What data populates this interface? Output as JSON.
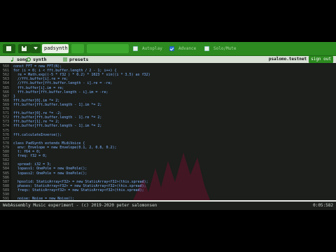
{
  "toolbar": {
    "project": "padsynth",
    "checkboxes": [
      {
        "label": "Autoplay",
        "checked": false
      },
      {
        "label": "Advance",
        "checked": true
      },
      {
        "label": "Solo/Mute",
        "checked": false
      }
    ]
  },
  "tabs": [
    {
      "label": "song",
      "icon": "music-icon"
    },
    {
      "label": "synth",
      "icon": "gear-icon"
    },
    {
      "label": "presets",
      "icon": "list-icon"
    }
  ],
  "account": {
    "user": "psalomo.testnet",
    "action": "sign out"
  },
  "editor": {
    "lines": [
      {
        "n": "560",
        "t": "const FFT = new FFT(N);"
      },
      {
        "n": "561",
        "t": "for (i = 0; i < fft.buffer.length / 2 - 1; i++) {"
      },
      {
        "n": "562",
        "t": "  re = Math.exp((-5 * f32 ) * 0.2) * 1023 * sin((i * 3.5) as f32)"
      },
      {
        "n": "563",
        "t": "  //fft.buffer[i].re = re;"
      },
      {
        "n": "564",
        "t": "  //fft.buffer[fft.buffer.length - i].re = -re;"
      },
      {
        "n": "565",
        "t": "  fft.buffer[i].im = re;"
      },
      {
        "n": "566",
        "t": "  fft.buffer[fft.buffer.length - i].im = -re;"
      },
      {
        "n": "567",
        "t": "}"
      },
      {
        "n": "568",
        "t": "fft.buffer[0].im *= 2;"
      },
      {
        "n": "569",
        "t": "fft.buffer[fft.buffer.length - 1].im *= 2;"
      },
      {
        "n": "570",
        "t": ""
      },
      {
        "n": "571",
        "t": "fft.buffer[0].re *= -2;"
      },
      {
        "n": "572",
        "t": "fft.buffer[fft.buffer.length - 1].re *= 2;"
      },
      {
        "n": "573",
        "t": "fft.buffer[1].re *= 2;"
      },
      {
        "n": "574",
        "t": "fft.buffer[fft.buffer.length - 1].im *= 2;"
      },
      {
        "n": "575",
        "t": ""
      },
      {
        "n": "576",
        "t": "fft.calculateInverse();"
      },
      {
        "n": "577",
        "t": ""
      },
      {
        "n": "578",
        "t": "class PadSynth extends MidiVoice {"
      },
      {
        "n": "579",
        "t": "  env: Envelope = new Envelope(0.1, 2, 0.8, 0.2);"
      },
      {
        "n": "580",
        "t": "  t: f64 = 0;"
      },
      {
        "n": "581",
        "t": "  freq: f32 = 0;"
      },
      {
        "n": "582",
        "t": ""
      },
      {
        "n": "583",
        "t": "  spread: i32 = 3;"
      },
      {
        "n": "584",
        "t": "  lopass1: OnePole = new OnePole();"
      },
      {
        "n": "585",
        "t": "  lopass2: OnePole = new OnePole();"
      },
      {
        "n": "586",
        "t": ""
      },
      {
        "n": "587",
        "t": "  hpsolid: StaticArray<f32> = new StaticArray<f32>(this.spread);"
      },
      {
        "n": "588",
        "t": "  phases: StaticArray<f32> = new StaticArray<f32>(this.spread);"
      },
      {
        "n": "589",
        "t": "  freqs: StaticArray<f32> = new StaticArray<f32>(this.spread);"
      },
      {
        "n": "590",
        "t": ""
      },
      {
        "n": "591",
        "t": "  noise: Noise = new Noise();"
      }
    ]
  },
  "status": {
    "left": "WebAssembly Music experiment - (c) 2019-2020 peter salomonsen",
    "right": "0:05:582"
  }
}
